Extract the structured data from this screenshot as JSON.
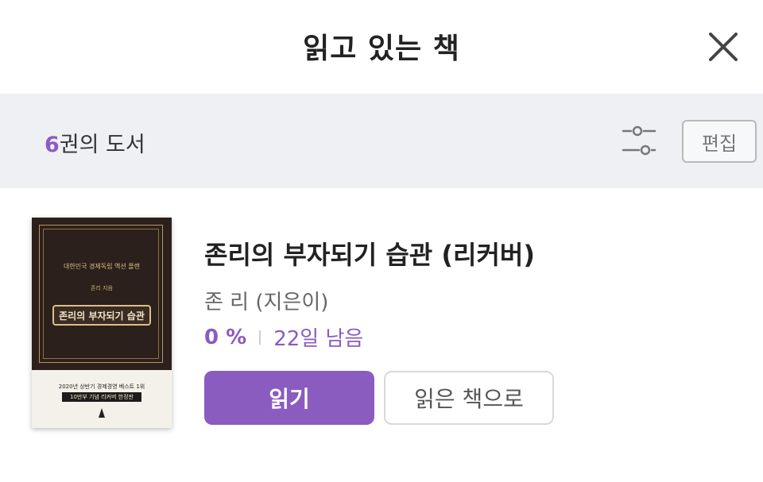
{
  "header": {
    "title": "읽고 있는 책"
  },
  "toolbar": {
    "count_number": "6",
    "count_suffix": "권의 도서",
    "edit_label": "편집"
  },
  "book": {
    "title": "존리의 부자되기 습관 (리커버)",
    "author": "존 리 (지은이)",
    "progress_percent": "0 %",
    "remaining": "22일 남음",
    "read_label": "읽기",
    "move_label": "읽은 책으로",
    "cover": {
      "subtitle": "대한민국 경제독립 액션 플랜",
      "author": "존리 지음",
      "title": "존리의 부자되기 습관",
      "band_text": "2020년 상반기 경제경영 베스트 1위",
      "band_text2": "10만부 기념 리커버 한정판"
    }
  },
  "colors": {
    "accent": "#8a5cc0",
    "toolbar_bg": "#eef0f3"
  },
  "icons": {
    "close": "close-icon",
    "filter": "filter-sliders-icon"
  }
}
